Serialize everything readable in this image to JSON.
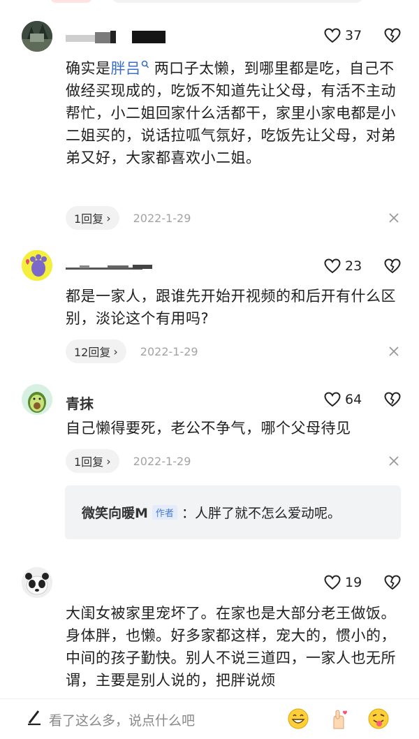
{
  "comments": [
    {
      "username": "",
      "likes": "37",
      "text_before": "确实是",
      "link": "胖吕",
      "text_after": "两口子太懒，到哪里都是吃，自己不做经买现成的，吃饭不知道先让父母，有活不主动帮忙，小二姐回家什么活都干，家里小家电都是小二姐买的，说话拉呱气氛好，吃饭先让父母，对弟弟又好，大家都喜欢小二姐。",
      "replies": "1回复",
      "date": "2022-1-29"
    },
    {
      "username": "",
      "likes": "23",
      "text": "都是一家人，跟谁先开始开视频的和后开有什么区别，淡论这个有用吗?",
      "replies": "12回复",
      "date": "2022-1-29"
    },
    {
      "username": "青抹",
      "likes": "64",
      "text": "自己懒得要死，老公不争气，哪个父母待见",
      "replies": "1回复",
      "date": "2022-1-29",
      "author_reply": {
        "name": "微笑向暖M",
        "tag": "作者",
        "text": "：人胖了就不怎么爱动呢。"
      }
    },
    {
      "username": "",
      "likes": "19",
      "text": "大闺女被家里宠坏了。在家也是大部分老王做饭。身体胖，也懒。好多家都这样，宠大的，惯小的，中间的孩子勤快。别人不说三道四，一家人也无所谓，主要是别人说的，把胖说烦"
    }
  ],
  "input": {
    "placeholder": "看了这么多，说点什么吧"
  },
  "icons": [
    "heart-icon",
    "broken-heart-icon",
    "close-icon",
    "pen-icon",
    "grin-emoji",
    "finger-heart-emoji",
    "tongue-emoji"
  ],
  "colors": {
    "link": "#3a6fc4",
    "date": "#a3a3a3",
    "chip": "#f2f2f2"
  }
}
